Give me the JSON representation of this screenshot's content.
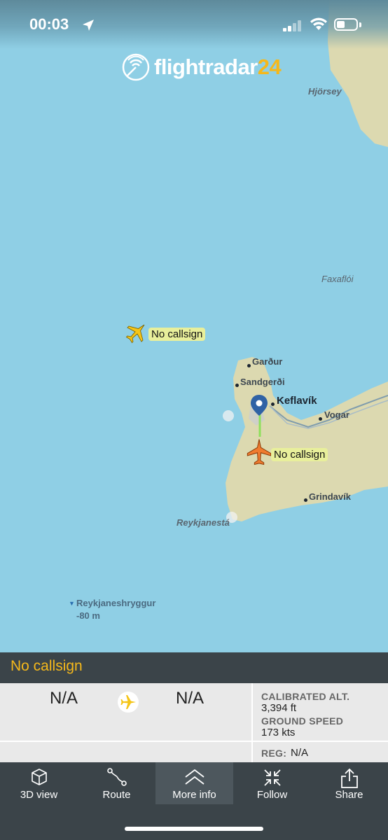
{
  "status": {
    "time": "00:03"
  },
  "app": {
    "logo_word": "flightradar",
    "logo_number": "24"
  },
  "map": {
    "places": {
      "hjorsey": "Hjörsey",
      "faxafloi": "Faxaflói",
      "gardur": "Garður",
      "sandgerdi": "Sandgerði",
      "keflavik": "Keflavík",
      "vogar": "Vogar",
      "grindavik": "Grindavík",
      "reykjanesta": "Reykjanestá",
      "reykjaneshryggur": "Reykjaneshryggur",
      "depth": "-80 m"
    },
    "aircraft": [
      {
        "label": "No callsign",
        "color": "#f5c518",
        "selected": false
      },
      {
        "label": "No callsign",
        "color": "#ef7b2f",
        "selected": true
      }
    ]
  },
  "selected_flight": {
    "callsign": "No callsign",
    "origin": "N/A",
    "destination": "N/A",
    "calibrated_alt_label": "CALIBRATED ALT.",
    "calibrated_alt_value": "3,394 ft",
    "ground_speed_label": "GROUND SPEED",
    "ground_speed_value": "173 kts",
    "reg_label": "REG:",
    "reg_value": "N/A"
  },
  "tabs": [
    {
      "label": "3D view",
      "icon": "cube-icon"
    },
    {
      "label": "Route",
      "icon": "route-icon"
    },
    {
      "label": "More info",
      "icon": "chevron-up-icon",
      "active": true
    },
    {
      "label": "Follow",
      "icon": "follow-arrows-icon"
    },
    {
      "label": "Share",
      "icon": "share-icon"
    }
  ],
  "colors": {
    "accent": "#f5b81b",
    "sea": "#8fcfe5",
    "land": "#dcd9b0",
    "bar": "#3b4449"
  }
}
